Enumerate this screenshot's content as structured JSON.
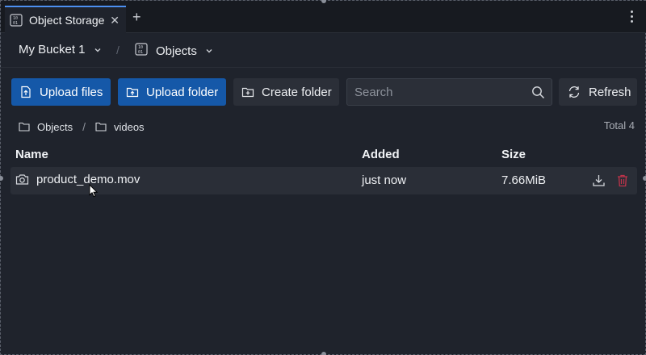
{
  "tab": {
    "title": "Object Storage",
    "close_glyph": "✕",
    "add_glyph": "+",
    "icon": "object-storage-icon"
  },
  "header": {
    "bucket": "My Bucket 1",
    "separator": "/",
    "section": "Objects"
  },
  "toolbar": {
    "upload_files": "Upload files",
    "upload_folder": "Upload folder",
    "create_folder": "Create folder",
    "search_placeholder": "Search",
    "search_value": "",
    "refresh": "Refresh"
  },
  "breadcrumb": {
    "items": [
      "Objects",
      "videos"
    ],
    "separator": "/"
  },
  "total": "Total 4",
  "table": {
    "columns": [
      "Name",
      "Added",
      "Size"
    ],
    "rows": [
      {
        "name": "product_demo.mov",
        "added": "just now",
        "size": "7.66MiB",
        "icon": "camera-icon"
      }
    ]
  },
  "colors": {
    "primary_button": "#1558a8",
    "accent_tab": "#4c8ff0",
    "delete_icon": "#c0334a",
    "background": "#1f232c"
  }
}
